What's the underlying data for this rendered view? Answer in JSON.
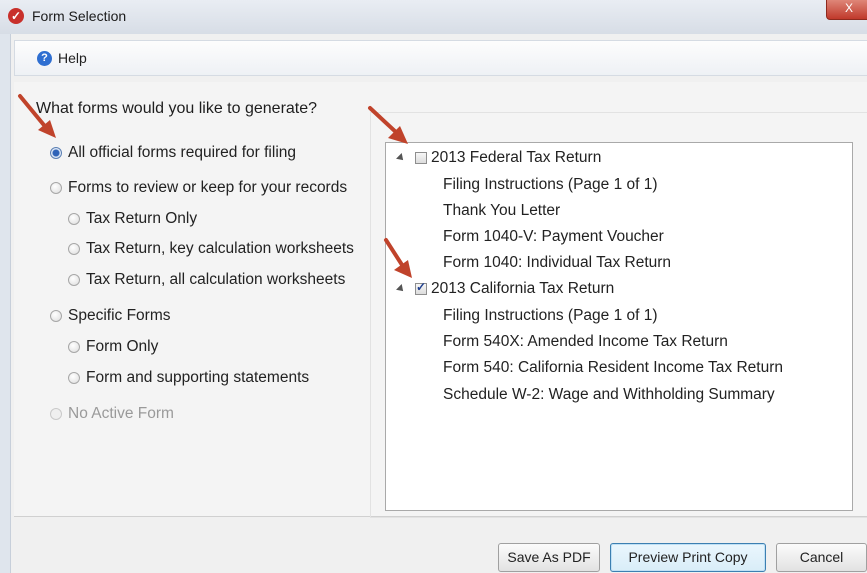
{
  "window": {
    "title": "Form Selection",
    "close_label": "X"
  },
  "menu": {
    "help_label": "Help"
  },
  "question": "What forms would you like to generate?",
  "options": [
    {
      "label": "All official forms required for filing",
      "checked": true,
      "disabled": false
    },
    {
      "label": "Forms to review or keep for your records",
      "checked": false,
      "disabled": false
    },
    {
      "label": "Tax Return Only",
      "checked": false,
      "disabled": false
    },
    {
      "label": "Tax Return, key calculation worksheets",
      "checked": false,
      "disabled": false
    },
    {
      "label": "Tax Return, all calculation worksheets",
      "checked": false,
      "disabled": false
    },
    {
      "label": "Specific Forms",
      "checked": false,
      "disabled": false
    },
    {
      "label": "Form Only",
      "checked": false,
      "disabled": false
    },
    {
      "label": "Form and supporting statements",
      "checked": false,
      "disabled": false
    },
    {
      "label": "No Active Form",
      "checked": false,
      "disabled": true
    }
  ],
  "tree": {
    "federal": {
      "label": "2013 Federal Tax Return",
      "checked": false,
      "items": [
        "Filing Instructions (Page 1 of 1)",
        "Thank You Letter",
        "Form 1040-V: Payment Voucher",
        "Form 1040: Individual Tax Return"
      ]
    },
    "california": {
      "label": "2013 California Tax Return",
      "checked": true,
      "items": [
        "Filing Instructions (Page 1 of 1)",
        "Form 540X: Amended Income Tax Return",
        "Form 540: California Resident Income Tax Return",
        "Schedule W-2: Wage and Withholding Summary"
      ]
    }
  },
  "buttons": {
    "save_pdf": "Save As PDF",
    "preview": "Preview Print Copy",
    "cancel": "Cancel"
  },
  "colors": {
    "annotation_arrow": "#c0432b",
    "accent": "#2f63b8"
  }
}
